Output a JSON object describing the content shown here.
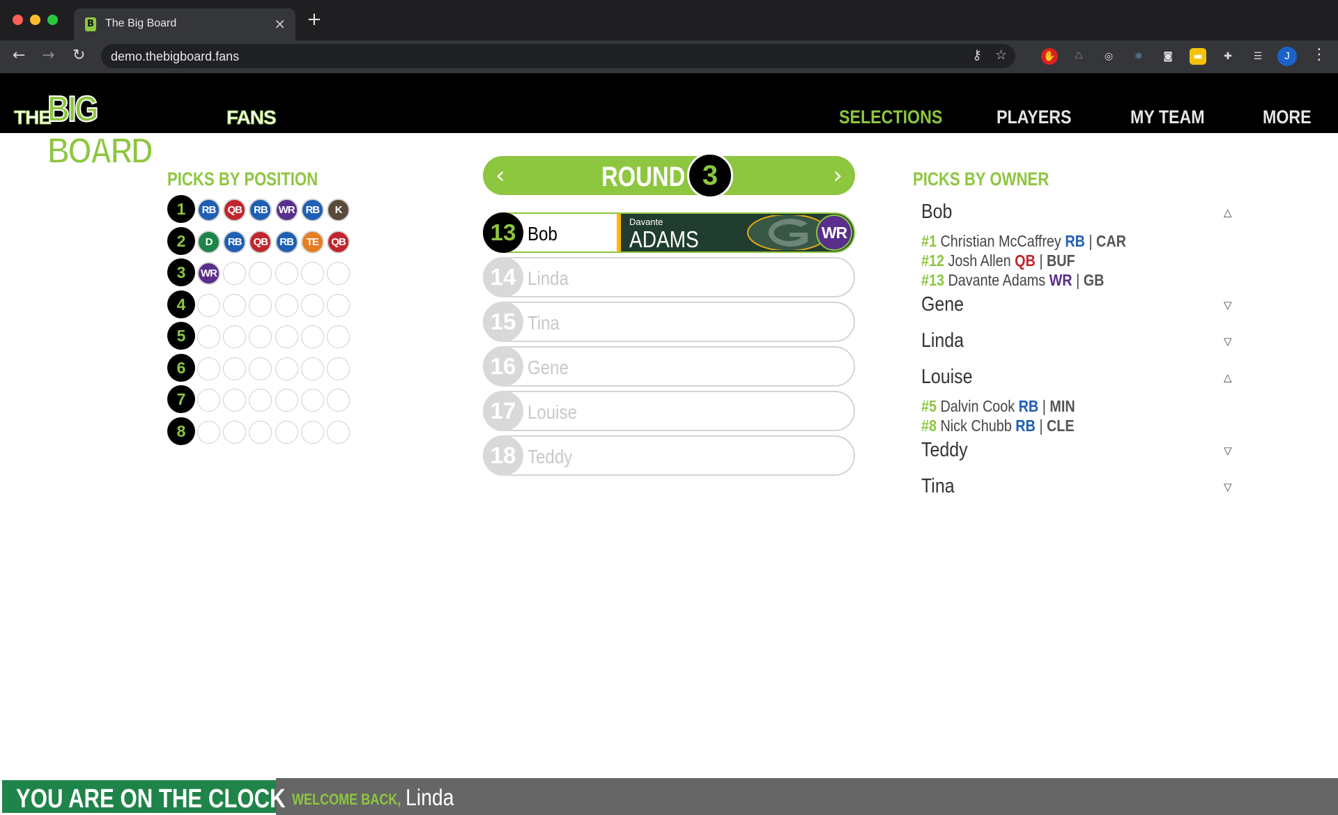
{
  "browser": {
    "tab_title": "The Big Board",
    "tab_favicon": "B",
    "url": "demo.thebigboard.fans",
    "profile_initial": "J"
  },
  "header": {
    "logo": {
      "the": "THE",
      "big_board": "BIG BOARD",
      "fans": "FANS"
    },
    "nav": [
      "SELECTIONS",
      "PLAYERS",
      "MY TEAM",
      "MORE"
    ],
    "active_nav": "SELECTIONS"
  },
  "picks_by_position": {
    "title": "PICKS BY POSITION",
    "rounds": [
      {
        "round": "1",
        "picks": [
          "RB",
          "QB",
          "RB",
          "WR",
          "RB",
          "K"
        ]
      },
      {
        "round": "2",
        "picks": [
          "D",
          "RB",
          "QB",
          "RB",
          "TE",
          "QB"
        ]
      },
      {
        "round": "3",
        "picks": [
          "WR",
          "",
          "",
          "",
          "",
          ""
        ]
      },
      {
        "round": "4",
        "picks": [
          "",
          "",
          "",
          "",
          "",
          ""
        ]
      },
      {
        "round": "5",
        "picks": [
          "",
          "",
          "",
          "",
          "",
          ""
        ]
      },
      {
        "round": "6",
        "picks": [
          "",
          "",
          "",
          "",
          "",
          ""
        ]
      },
      {
        "round": "7",
        "picks": [
          "",
          "",
          "",
          "",
          "",
          ""
        ]
      },
      {
        "round": "8",
        "picks": [
          "",
          "",
          "",
          "",
          "",
          ""
        ]
      }
    ]
  },
  "position_colors": {
    "RB": "#1f5fb4",
    "QB": "#c0262d",
    "WR": "#5a2e8c",
    "K": "#5a4a3a",
    "D": "#1e8449",
    "TE": "#e67e22"
  },
  "round_nav": {
    "label": "ROUND",
    "number": "3",
    "prev_icon": "chevron-left-icon",
    "next_icon": "chevron-right-icon"
  },
  "picks": [
    {
      "number": "13",
      "owner": "Bob",
      "current": true,
      "player": {
        "first": "Davante",
        "last": "ADAMS",
        "position": "WR",
        "team": "GB"
      }
    },
    {
      "number": "14",
      "owner": "Linda"
    },
    {
      "number": "15",
      "owner": "Tina"
    },
    {
      "number": "16",
      "owner": "Gene"
    },
    {
      "number": "17",
      "owner": "Louise"
    },
    {
      "number": "18",
      "owner": "Teddy"
    }
  ],
  "picks_by_owner": {
    "title": "PICKS BY OWNER",
    "owners": [
      {
        "name": "Bob",
        "expanded": true,
        "toggle": "△",
        "picks": [
          {
            "num": "#1",
            "player": "Christian McCaffrey",
            "pos": "RB",
            "team": "CAR"
          },
          {
            "num": "#12",
            "player": "Josh Allen",
            "pos": "QB",
            "team": "BUF"
          },
          {
            "num": "#13",
            "player": "Davante Adams",
            "pos": "WR",
            "team": "GB"
          }
        ]
      },
      {
        "name": "Gene",
        "expanded": false,
        "toggle": "▽",
        "picks": []
      },
      {
        "name": "Linda",
        "expanded": false,
        "toggle": "▽",
        "picks": []
      },
      {
        "name": "Louise",
        "expanded": true,
        "toggle": "△",
        "picks": [
          {
            "num": "#5",
            "player": "Dalvin Cook",
            "pos": "RB",
            "team": "MIN"
          },
          {
            "num": "#8",
            "player": "Nick Chubb",
            "pos": "RB",
            "team": "CLE"
          }
        ]
      },
      {
        "name": "Teddy",
        "expanded": false,
        "toggle": "▽",
        "picks": []
      },
      {
        "name": "Tina",
        "expanded": false,
        "toggle": "▽",
        "picks": []
      }
    ]
  },
  "footer": {
    "status": "YOU ARE ON THE CLOCK",
    "welcome": "WELCOME BACK,",
    "user": "Linda"
  }
}
